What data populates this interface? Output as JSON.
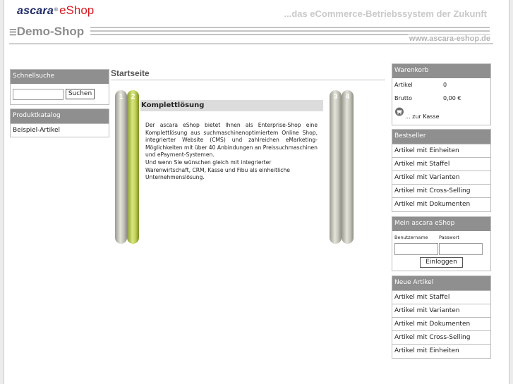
{
  "header": {
    "brand": "ascara",
    "reg_mark": "®",
    "brand_suffix": "eShop",
    "tagline": "...das eCommerce-Betriebssystem der Zukunft",
    "shop_name": "Demo-Shop",
    "url": "www.ascara-eshop.de"
  },
  "quicksearch": {
    "title": "Schnellsuche",
    "input_value": "",
    "button_label": "Suchen"
  },
  "catalog": {
    "title": "Produktkatalog",
    "items": [
      "Beispiel-Artikel"
    ]
  },
  "main": {
    "title": "Startseite",
    "pillars": [
      "1",
      "2",
      "3",
      "4"
    ],
    "content_heading": "Komplettlösung",
    "paragraph1": "Der ascara eShop bietet Ihnen als Enterprise-Shop eine Komplettlösung aus suchmaschinenoptimiertem Online Shop, integrierter Website (CMS) und zahlreichen eMarketing-Möglichkeiten mit über 40 Anbindungen an Preissuchmaschinen und ePayment-Systemen.",
    "paragraph2": "Und wenn Sie wünschen gleich mit integrierter Warenwirtschaft, CRM, Kasse und Fibu als einheitliche Unternehmenslösung."
  },
  "cart": {
    "title": "Warenkorb",
    "articles_label": "Artikel",
    "articles_value": "0",
    "gross_label": "Brutto",
    "gross_value": "0,00 €",
    "checkout_label": "... zur Kasse"
  },
  "bestseller": {
    "title": "Bestseller",
    "items": [
      "Artikel mit Einheiten",
      "Artikel mit Staffel",
      "Artikel mit Varianten",
      "Artikel mit Cross-Selling",
      "Artikel mit Dokumenten"
    ]
  },
  "login": {
    "title": "Mein ascara eShop",
    "user_label": "Benutzername",
    "password_label": "Passwort",
    "button_label": "Einloggen"
  },
  "new_articles": {
    "title": "Neue Artikel",
    "items": [
      "Artikel mit Staffel",
      "Artikel mit Varianten",
      "Artikel mit Dokumenten",
      "Artikel mit Cross-Selling",
      "Artikel mit Einheiten"
    ]
  }
}
